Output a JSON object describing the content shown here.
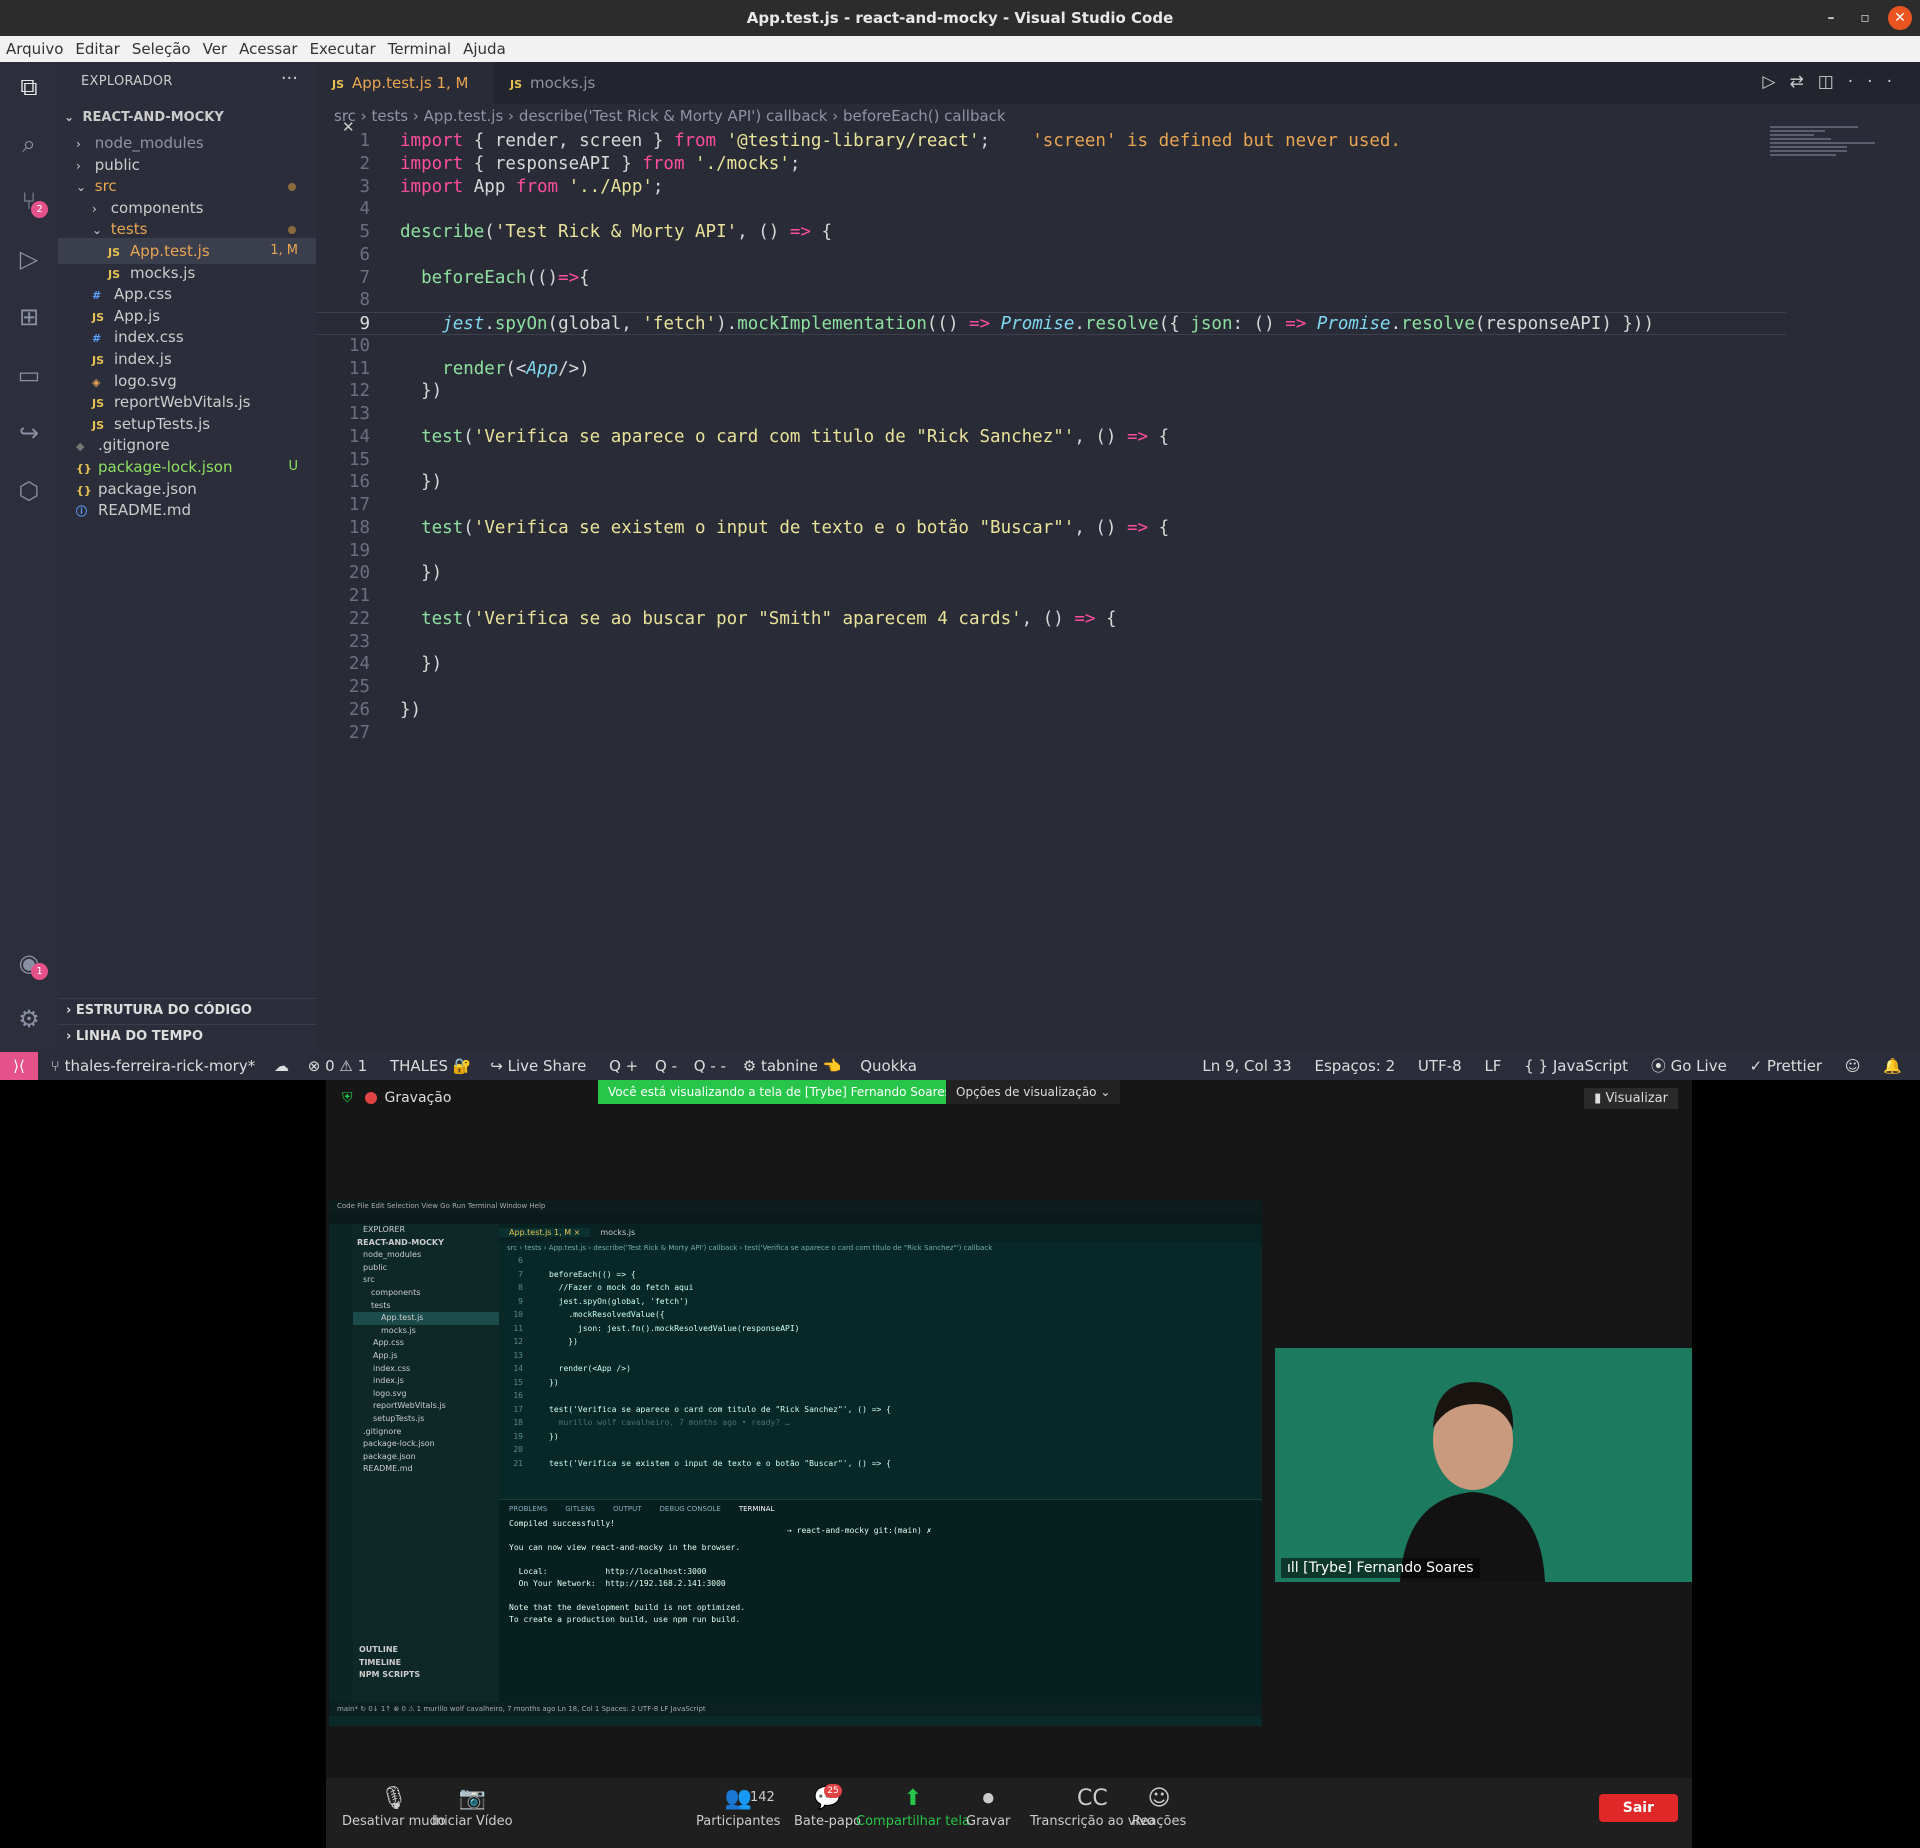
{
  "window": {
    "title": "App.test.js - react-and-mocky - Visual Studio Code"
  },
  "menu": [
    "Arquivo",
    "Editar",
    "Seleção",
    "Ver",
    "Acessar",
    "Executar",
    "Terminal",
    "Ajuda"
  ],
  "activity": {
    "scm_badge": "2",
    "account_badge": "1"
  },
  "explorer": {
    "title": "EXPLORADOR",
    "root": "REACT-AND-MOCKY",
    "items": [
      {
        "label": "node_modules",
        "type": "folder",
        "indent": 1,
        "open": false,
        "color": "#8f93a3"
      },
      {
        "label": "public",
        "type": "folder",
        "indent": 1,
        "open": false,
        "color": "#cccccc"
      },
      {
        "label": "src",
        "type": "folder",
        "indent": 1,
        "open": true,
        "color": "#e8a552",
        "dot": true
      },
      {
        "label": "components",
        "type": "folder",
        "indent": 2,
        "open": false,
        "color": "#cccccc"
      },
      {
        "label": "tests",
        "type": "folder",
        "indent": 2,
        "open": true,
        "color": "#e8a552",
        "dot": true
      },
      {
        "label": "App.test.js",
        "type": "js",
        "indent": 3,
        "color": "#e8a552",
        "deco": "1, M",
        "selected": true
      },
      {
        "label": "mocks.js",
        "type": "js",
        "indent": 3,
        "color": "#cccccc"
      },
      {
        "label": "App.css",
        "type": "css",
        "indent": 2,
        "color": "#cccccc"
      },
      {
        "label": "App.js",
        "type": "js",
        "indent": 2,
        "color": "#cccccc"
      },
      {
        "label": "index.css",
        "type": "css",
        "indent": 2,
        "color": "#cccccc"
      },
      {
        "label": "index.js",
        "type": "js",
        "indent": 2,
        "color": "#cccccc"
      },
      {
        "label": "logo.svg",
        "type": "svg",
        "indent": 2,
        "color": "#cccccc"
      },
      {
        "label": "reportWebVitals.js",
        "type": "js",
        "indent": 2,
        "color": "#cccccc"
      },
      {
        "label": "setupTests.js",
        "type": "js",
        "indent": 2,
        "color": "#cccccc"
      },
      {
        "label": ".gitignore",
        "type": "git",
        "indent": 1,
        "color": "#cccccc"
      },
      {
        "label": "package-lock.json",
        "type": "json",
        "indent": 1,
        "color": "#8ee060",
        "deco": "U"
      },
      {
        "label": "package.json",
        "type": "json",
        "indent": 1,
        "color": "#cccccc"
      },
      {
        "label": "README.md",
        "type": "info",
        "indent": 1,
        "color": "#cccccc"
      }
    ],
    "outline": "ESTRUTURA DO CÓDIGO",
    "timeline": "LINHA DO TEMPO"
  },
  "tabs": [
    {
      "label": "App.test.js",
      "deco": "1, M",
      "active": true
    },
    {
      "label": "mocks.js",
      "active": false
    }
  ],
  "breadcrumb": [
    "src",
    "tests",
    "App.test.js",
    "describe('Test Rick & Morty API') callback",
    "beforeEach() callback"
  ],
  "code": [
    {
      "n": 1,
      "html": "<span class='kw'>import</span> { render, screen } <span class='kw'>from</span> <span class='str'>'@testing-library/react'</span>;    <span class='err'>'screen' is defined but never used.</span>"
    },
    {
      "n": 2,
      "html": "<span class='kw'>import</span> { responseAPI } <span class='kw'>from</span> <span class='str'>'./mocks'</span>;"
    },
    {
      "n": 3,
      "html": "<span class='kw'>import</span> App <span class='kw'>from</span> <span class='str'>'../App'</span>;"
    },
    {
      "n": 4,
      "html": ""
    },
    {
      "n": 5,
      "html": "<span class='fn'>describe</span>(<span class='str'>'Test Rick &amp; Morty API'</span>, () <span class='kw'>=&gt;</span> {"
    },
    {
      "n": 6,
      "html": ""
    },
    {
      "n": 7,
      "html": "  <span class='fn'>beforeEach</span>(()<span class='kw'>=&gt;</span>{"
    },
    {
      "n": 8,
      "html": ""
    },
    {
      "n": 9,
      "html": "    <span class='ital'>jest</span>.<span class='fn'>spyOn</span>(global, <span class='str'>'fetch'</span>).<span class='fn'>mockImplementation</span>(() <span class='kw'>=&gt;</span> <span class='ital'>Promise</span>.<span class='fn'>resolve</span>({ <span class='fn'>json</span>: () <span class='kw'>=&gt;</span> <span class='ital'>Promise</span>.<span class='fn'>resolve</span>(responseAPI) }))"
    },
    {
      "n": 10,
      "html": ""
    },
    {
      "n": 11,
      "html": "    <span class='fn'>render</span>(&lt;<span class='ital'>App</span>/&gt;)"
    },
    {
      "n": 12,
      "html": "  })"
    },
    {
      "n": 13,
      "html": ""
    },
    {
      "n": 14,
      "html": "  <span class='fn'>test</span>(<span class='str'>'Verifica se aparece o card com titulo de \"Rick Sanchez\"'</span>, () <span class='kw'>=&gt;</span> {"
    },
    {
      "n": 15,
      "html": ""
    },
    {
      "n": 16,
      "html": "  })"
    },
    {
      "n": 17,
      "html": ""
    },
    {
      "n": 18,
      "html": "  <span class='fn'>test</span>(<span class='str'>'Verifica se existem o input de texto e o botão \"Buscar\"'</span>, () <span class='kw'>=&gt;</span> {"
    },
    {
      "n": 19,
      "html": ""
    },
    {
      "n": 20,
      "html": "  })"
    },
    {
      "n": 21,
      "html": ""
    },
    {
      "n": 22,
      "html": "  <span class='fn'>test</span>(<span class='str'>'Verifica se ao buscar por \"Smith\" aparecem 4 cards'</span>, () <span class='kw'>=&gt;</span> {"
    },
    {
      "n": 23,
      "html": ""
    },
    {
      "n": 24,
      "html": "  })"
    },
    {
      "n": 25,
      "html": ""
    },
    {
      "n": 26,
      "html": "})"
    },
    {
      "n": 27,
      "html": ""
    }
  ],
  "current_line": 9,
  "status": {
    "branch": "thales-ferreira-rick-mory*",
    "problems": "⊗ 0 ⚠ 1",
    "user": "THALES 🔐",
    "liveshare": "Live Share",
    "q1": "Q +",
    "q2": "Q -",
    "q3": "Q - -",
    "tabnine": "tabnine 👈",
    "quokka": "Quokka",
    "position": "Ln 9, Col 33",
    "spaces": "Espaços: 2",
    "encoding": "UTF-8",
    "eol": "LF",
    "language": "{ } JavaScript",
    "golive": "Go Live",
    "prettier": "✓ Prettier"
  },
  "zoom": {
    "recording": "Gravação",
    "banner": "Você está visualizando a tela de [Trybe] Fernando Soares",
    "view_options": "Opções de visualização ⌄",
    "visualizar": "Visualizar",
    "cam_name": "[Trybe] Fernando Soares",
    "buttons": [
      {
        "label": "Desativar mudo",
        "icon": "🎙"
      },
      {
        "label": "Iniciar Vídeo",
        "icon": "📷"
      },
      {
        "label": "Participantes",
        "icon": "👥",
        "count": "142"
      },
      {
        "label": "Bate-papo",
        "icon": "💬",
        "badge": "25"
      },
      {
        "label": "Compartilhar tela",
        "icon": "⬆",
        "green": true
      },
      {
        "label": "Gravar",
        "icon": "⏺"
      },
      {
        "label": "Transcrição ao vivo",
        "icon": "CC"
      },
      {
        "label": "Reações",
        "icon": "☺"
      }
    ],
    "leave": "Sair"
  },
  "shared": {
    "menu": " Code   File   Edit   Selection   View   Go   Run   Terminal   Window   Help",
    "explorer": "EXPLORER",
    "root": "REACT-AND-MOCKY",
    "files": [
      "node_modules",
      "public",
      "src",
      "components",
      "tests",
      "App.test.js",
      "mocks.js",
      "App.css",
      "App.js",
      "index.css",
      "index.js",
      "logo.svg",
      "reportWebVitals.js",
      "setupTests.js",
      ".gitignore",
      "package-lock.json",
      "package.json",
      "README.md"
    ],
    "tabs": [
      "App.test.js 1, M ×",
      "mocks.js"
    ],
    "crumb": "src › tests › App.test.js › describe('Test Rick & Morty API') callback › test('Verifica se aparece o card com titulo de \"Rick Sanchez\"') callback",
    "code": [
      {
        "n": "6",
        "t": ""
      },
      {
        "n": "7",
        "t": "beforeEach(() => {"
      },
      {
        "n": "8",
        "t": "  //Fazer o mock do fetch aqui"
      },
      {
        "n": "9",
        "t": "  jest.spyOn(global, 'fetch')"
      },
      {
        "n": "10",
        "t": "    .mockResolvedValue({"
      },
      {
        "n": "11",
        "t": "      json: jest.fn().mockResolvedValue(responseAPI)"
      },
      {
        "n": "12",
        "t": "    })"
      },
      {
        "n": "13",
        "t": ""
      },
      {
        "n": "14",
        "t": "  render(<App />)"
      },
      {
        "n": "15",
        "t": "})"
      },
      {
        "n": "16",
        "t": ""
      },
      {
        "n": "17",
        "t": "test('Verifica se aparece o card com titulo de \"Rick Sanchez\"', () => {"
      },
      {
        "n": "18",
        "t": "  murillo wolf cavalheiro, 7 months ago • ready? …"
      },
      {
        "n": "19",
        "t": "})"
      },
      {
        "n": "20",
        "t": ""
      },
      {
        "n": "21",
        "t": "test('Verifica se existem o input de texto e o botão \"Buscar\"', () => {"
      }
    ],
    "panel_tabs": [
      "PROBLEMS",
      "GITLENS",
      "OUTPUT",
      "DEBUG CONSOLE",
      "TERMINAL"
    ],
    "terminal": [
      "Compiled successfully!",
      "",
      "You can now view react-and-mocky in the browser.",
      "",
      "  Local:            http://localhost:3000",
      "  On Your Network:  http://192.168.2.141:3000",
      "",
      "Note that the development build is not optimized.",
      "To create a production build, use npm run build."
    ],
    "term2": "→ react-and-mocky git:(main) ✗",
    "outline": [
      "OUTLINE",
      "TIMELINE",
      "NPM SCRIPTS"
    ],
    "status": "main*   ↻ 0↓ 1↑   ⊗ 0 ⚠ 1                                                                         murillo wolf cavalheiro, 7 months ago   Ln 18, Col 1   Spaces: 2   UTF-8   LF   JavaScript"
  }
}
